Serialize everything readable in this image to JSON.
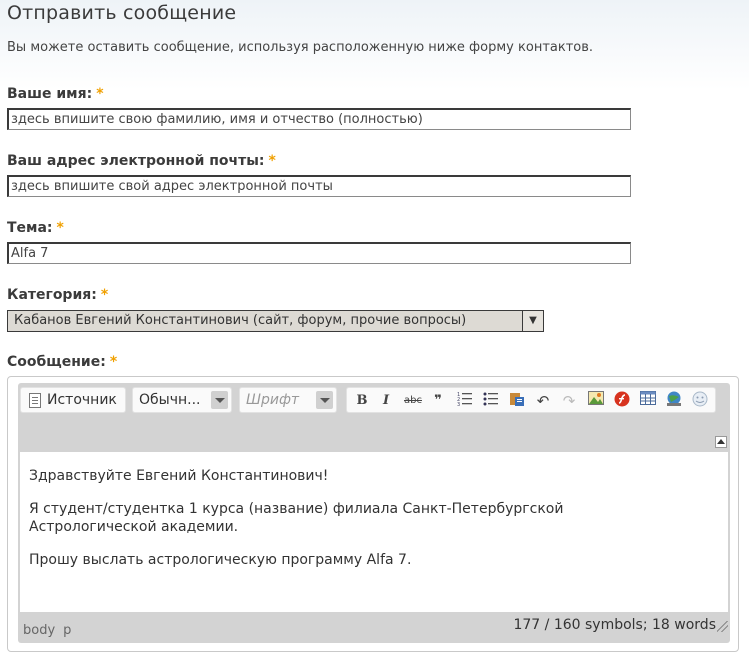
{
  "page": {
    "title": "Отправить сообщение",
    "intro": "Вы можете оставить сообщение, используя расположенную ниже форму контактов."
  },
  "form": {
    "required_marker": "*",
    "name": {
      "label": "Ваше имя:",
      "value": "здесь впишите свою фамилию, имя и отчество (полностью)"
    },
    "email": {
      "label": "Ваш адрес электронной почты:",
      "value": "здесь впишите свой адрес электронной почты"
    },
    "subject": {
      "label": "Тема:",
      "value": "Alfa 7"
    },
    "category": {
      "label": "Категория:",
      "selected": "Кабанов Евгений Константинович (сайт, форум, прочие вопросы)"
    },
    "message": {
      "label": "Сообщение:"
    }
  },
  "editor": {
    "toolbar": {
      "source_label": "Источник",
      "format_value": "Обычн...",
      "font_placeholder": "Шрифт",
      "icons": [
        "bold-icon",
        "italic-icon",
        "strikethrough-icon",
        "blockquote-icon",
        "numbered-list-icon",
        "bulleted-list-icon",
        "paste-word-icon",
        "undo-icon",
        "redo-icon",
        "image-icon",
        "flash-icon",
        "table-icon",
        "link-icon",
        "smiley-icon"
      ],
      "bold_glyph": "B",
      "italic_glyph": "I",
      "strike_glyph": "abc",
      "quote_glyph": "❞"
    },
    "content": {
      "p1": "Здравствуйте Евгений Константинович!",
      "p2": "Я студент/студентка 1 курса (название) филиала Санкт-Петербургской Астрологической академии.",
      "p3": "Прошу выслать астрологическую программу Alfa 7."
    },
    "status": {
      "path": [
        "body",
        "p"
      ],
      "counter": "177 / 160 symbols; 18 words"
    }
  }
}
